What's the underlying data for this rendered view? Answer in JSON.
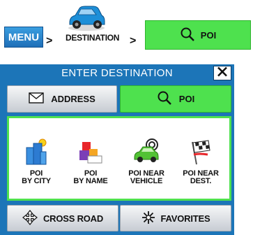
{
  "breadcrumb": {
    "menu_label": "MENU",
    "sep1": ">",
    "destination_label": "DESTINATION",
    "sep2": ">",
    "poi_label": "POI"
  },
  "window": {
    "title": "ENTER DESTINATION",
    "close_glyph": "✕"
  },
  "tabs": [
    {
      "label": "ADDRESS",
      "icon": "envelope-icon",
      "active": false
    },
    {
      "label": "POI",
      "icon": "search-icon",
      "active": true
    }
  ],
  "poi_options": [
    {
      "line1": "POI",
      "line2": "BY CITY",
      "icon": "city-buildings-icon"
    },
    {
      "line1": "POI",
      "line2": "BY NAME",
      "icon": "blocks-name-icon"
    },
    {
      "line1": "POI NEAR",
      "line2": "VEHICLE",
      "icon": "car-target-icon"
    },
    {
      "line1": "POI NEAR",
      "line2": "DEST.",
      "icon": "checkered-flag-icon"
    }
  ],
  "bottom_buttons": [
    {
      "label": "CROSS ROAD",
      "icon": "crossroad-icon"
    },
    {
      "label": "FAVORITES",
      "icon": "favorites-star-icon"
    }
  ],
  "colors": {
    "accent_green": "#4ee14e",
    "title_blue": "#1c75b8"
  }
}
